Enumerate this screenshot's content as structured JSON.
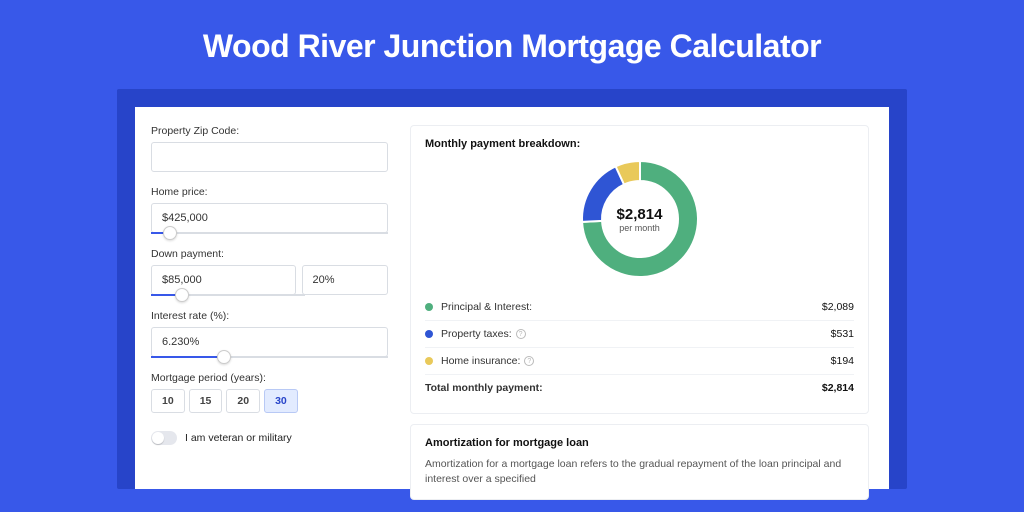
{
  "title": "Wood River Junction Mortgage Calculator",
  "form": {
    "zip": {
      "label": "Property Zip Code:",
      "value": ""
    },
    "home_price": {
      "label": "Home price:",
      "value": "$425,000",
      "slider_pct": 8
    },
    "down_payment": {
      "label": "Down payment:",
      "value": "$85,000",
      "pct": "20%",
      "slider_pct": 20
    },
    "interest": {
      "label": "Interest rate (%):",
      "value": "6.230%",
      "slider_pct": 31
    },
    "period": {
      "label": "Mortgage period (years):",
      "options": [
        "10",
        "15",
        "20",
        "30"
      ],
      "selected": "30"
    },
    "veteran": {
      "label": "I am veteran or military",
      "checked": false
    }
  },
  "breakdown": {
    "title": "Monthly payment breakdown:",
    "total_amount": "$2,814",
    "per_month": "per month",
    "items": [
      {
        "label": "Principal & Interest:",
        "value": "$2,089",
        "color": "#4FAF7E",
        "info": false,
        "pct": 74.2
      },
      {
        "label": "Property taxes:",
        "value": "$531",
        "color": "#2F55D4",
        "info": true,
        "pct": 18.9
      },
      {
        "label": "Home insurance:",
        "value": "$194",
        "color": "#E9C95A",
        "info": true,
        "pct": 6.9
      }
    ],
    "total_label": "Total monthly payment:",
    "total_value": "$2,814"
  },
  "amortization": {
    "title": "Amortization for mortgage loan",
    "body": "Amortization for a mortgage loan refers to the gradual repayment of the loan principal and interest over a specified"
  },
  "chart_data": {
    "type": "pie",
    "title": "Monthly payment breakdown",
    "series": [
      {
        "name": "Principal & Interest",
        "value": 2089,
        "color": "#4FAF7E"
      },
      {
        "name": "Property taxes",
        "value": 531,
        "color": "#2F55D4"
      },
      {
        "name": "Home insurance",
        "value": 194,
        "color": "#E9C95A"
      }
    ],
    "total": 2814,
    "unit": "USD/month"
  }
}
